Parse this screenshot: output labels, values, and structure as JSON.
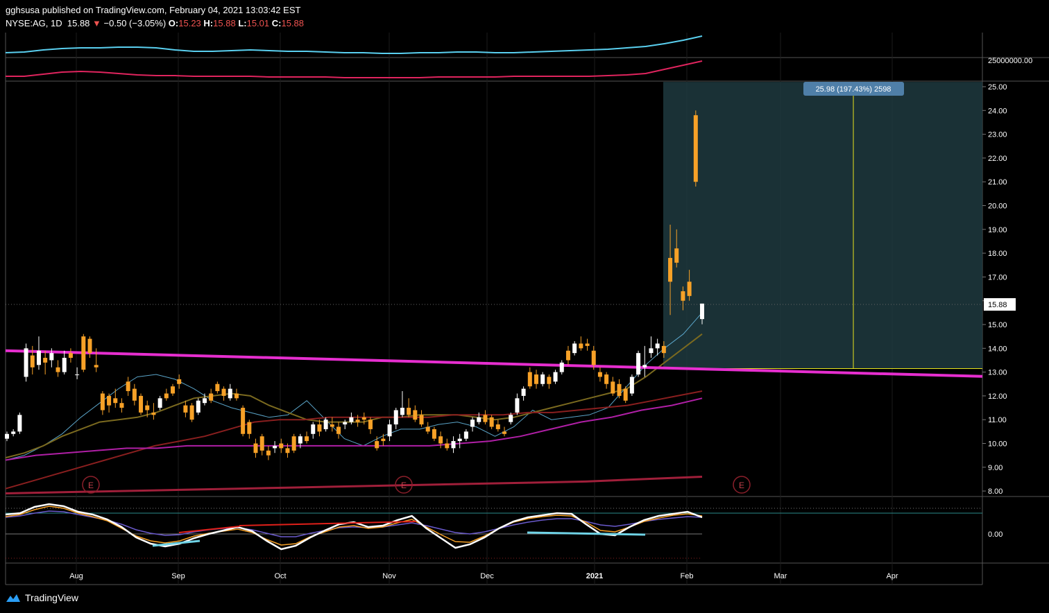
{
  "header": {
    "line1": "gghsusa published on TradingView.com, February 04, 2021 13:03:42 EST",
    "symbol": "NYSE:AG, 1D",
    "last": "15.88",
    "arrow": "▼",
    "change": "−0.50 (−3.05%)",
    "o_label": "O:",
    "o_value": "15.23",
    "h_label": "H:",
    "h_value": "15.88",
    "l_label": "L:",
    "l_value": "15.01",
    "c_label": "C:",
    "c_value": "15.88"
  },
  "footer": {
    "brand": "TradingView"
  },
  "colors": {
    "up_candle": "#ffffff",
    "down_candle": "#f7a127",
    "trendline": "#e62ecf",
    "ma_fast": "#5aa4c8",
    "ma_mid": "#7b6a1f",
    "ma_slow": "#8a1f1f",
    "ma_long": "#b01fa6",
    "projection_fill": "#1f3a3f",
    "volume_ma_top": "#5ad0f0",
    "volume_ma_bottom": "#e0245e"
  },
  "chart_data": {
    "type": "candlestick",
    "price_axis": [
      "25.00",
      "24.00",
      "23.00",
      "22.00",
      "21.00",
      "20.00",
      "19.00",
      "18.00",
      "17.00",
      "16.00",
      "15.00",
      "14.00",
      "13.00",
      "12.00",
      "11.00",
      "10.00",
      "9.00",
      "8.00"
    ],
    "ylim": [
      7.8,
      25.2
    ],
    "current_price_label": "15.88",
    "volume_axis_label": "25000000.00",
    "oscillator_axis_label": "0.00",
    "x_labels": [
      "Aug",
      "Sep",
      "Oct",
      "Nov",
      "Dec",
      "2021",
      "Feb",
      "Mar",
      "Apr"
    ],
    "earnings_marker": "E",
    "projection_label": "25.98 (197.43%) 2598",
    "projection": {
      "from_price": 13.15,
      "to_price": 25.2,
      "start_date": "2021-01-23",
      "end_date": "2021-03-19"
    },
    "trendline": {
      "start": 13.9,
      "end": 12.82
    },
    "candles": [
      [
        10.2,
        10.5,
        10.1,
        10.4
      ],
      [
        10.4,
        10.6,
        10.3,
        10.5
      ],
      [
        10.5,
        11.3,
        10.4,
        11.2
      ],
      [
        12.8,
        14.2,
        12.6,
        14.0
      ],
      [
        13.7,
        14.1,
        12.9,
        13.2
      ],
      [
        13.3,
        14.5,
        13.1,
        13.9
      ],
      [
        13.6,
        13.9,
        12.9,
        13.4
      ],
      [
        13.5,
        14.0,
        13.2,
        13.8
      ],
      [
        13.2,
        13.5,
        12.8,
        13.0
      ],
      [
        13.0,
        13.9,
        12.9,
        13.6
      ],
      [
        13.8,
        14.0,
        13.4,
        13.6
      ],
      [
        12.9,
        13.2,
        12.7,
        12.9
      ],
      [
        14.5,
        14.6,
        13.0,
        13.1
      ],
      [
        14.4,
        14.5,
        13.6,
        13.8
      ],
      [
        13.3,
        14.0,
        13.0,
        13.2
      ],
      [
        12.1,
        12.2,
        11.2,
        11.4
      ],
      [
        12.0,
        12.1,
        11.3,
        11.6
      ],
      [
        11.9,
        12.3,
        11.5,
        11.7
      ],
      [
        11.7,
        11.9,
        11.3,
        11.5
      ],
      [
        12.6,
        12.8,
        12.0,
        12.2
      ],
      [
        12.3,
        12.5,
        11.6,
        11.8
      ],
      [
        12.0,
        12.1,
        11.2,
        11.3
      ],
      [
        11.6,
        11.8,
        11.1,
        11.4
      ],
      [
        11.3,
        11.7,
        11.0,
        11.2
      ],
      [
        11.5,
        12.0,
        11.4,
        11.9
      ],
      [
        12.1,
        12.3,
        11.8,
        11.9
      ],
      [
        12.4,
        12.5,
        12.0,
        12.1
      ],
      [
        12.7,
        12.9,
        12.3,
        12.5
      ],
      [
        11.6,
        11.8,
        11.1,
        11.3
      ],
      [
        11.6,
        11.7,
        10.9,
        11.0
      ],
      [
        11.3,
        11.9,
        11.2,
        11.8
      ],
      [
        11.7,
        12.1,
        11.6,
        11.9
      ],
      [
        12.1,
        12.3,
        11.7,
        11.8
      ],
      [
        12.5,
        12.6,
        12.1,
        12.2
      ],
      [
        12.3,
        12.4,
        11.8,
        12.0
      ],
      [
        11.9,
        12.5,
        11.8,
        12.3
      ],
      [
        12.1,
        12.3,
        11.8,
        11.9
      ],
      [
        11.5,
        11.6,
        10.3,
        10.4
      ],
      [
        10.9,
        11.0,
        10.2,
        10.4
      ],
      [
        10.0,
        10.2,
        9.4,
        9.6
      ],
      [
        10.3,
        10.4,
        9.5,
        9.7
      ],
      [
        9.7,
        9.9,
        9.3,
        9.5
      ],
      [
        9.8,
        10.1,
        9.6,
        9.9
      ],
      [
        10.0,
        10.2,
        9.6,
        9.8
      ],
      [
        9.8,
        10.0,
        9.4,
        9.6
      ],
      [
        10.3,
        10.4,
        9.6,
        9.7
      ],
      [
        10.0,
        10.4,
        9.8,
        10.3
      ],
      [
        10.3,
        10.5,
        10.0,
        10.1
      ],
      [
        10.4,
        10.9,
        10.2,
        10.8
      ],
      [
        10.8,
        11.0,
        10.3,
        10.5
      ],
      [
        10.6,
        11.1,
        10.5,
        11.0
      ],
      [
        10.8,
        11.1,
        10.5,
        10.7
      ],
      [
        10.7,
        10.9,
        10.2,
        10.4
      ],
      [
        10.8,
        11.0,
        10.6,
        10.9
      ],
      [
        10.9,
        11.3,
        10.8,
        11.1
      ],
      [
        11.0,
        11.2,
        10.7,
        10.9
      ],
      [
        11.1,
        11.3,
        10.8,
        11.0
      ],
      [
        11.0,
        11.1,
        10.4,
        10.6
      ],
      [
        10.1,
        10.3,
        9.7,
        9.8
      ],
      [
        10.2,
        10.4,
        9.9,
        10.1
      ],
      [
        10.3,
        11.0,
        10.1,
        10.8
      ],
      [
        10.8,
        11.5,
        10.6,
        11.4
      ],
      [
        11.2,
        12.2,
        11.1,
        11.5
      ],
      [
        11.5,
        11.9,
        11.1,
        11.2
      ],
      [
        11.4,
        11.6,
        10.9,
        11.0
      ],
      [
        11.2,
        11.4,
        10.7,
        10.8
      ],
      [
        10.7,
        10.9,
        10.4,
        10.5
      ],
      [
        10.6,
        10.7,
        10.1,
        10.2
      ],
      [
        10.3,
        10.5,
        9.8,
        10.0
      ],
      [
        10.0,
        10.2,
        9.7,
        9.8
      ],
      [
        9.8,
        10.3,
        9.6,
        10.1
      ],
      [
        10.1,
        10.4,
        9.8,
        10.2
      ],
      [
        10.2,
        10.6,
        10.1,
        10.5
      ],
      [
        10.7,
        11.1,
        10.5,
        11.0
      ],
      [
        10.9,
        11.3,
        10.8,
        11.1
      ],
      [
        11.2,
        11.4,
        10.8,
        10.9
      ],
      [
        11.1,
        11.2,
        10.6,
        10.7
      ],
      [
        10.8,
        11.0,
        10.5,
        10.6
      ],
      [
        10.5,
        10.7,
        10.3,
        10.4
      ],
      [
        10.9,
        11.3,
        10.8,
        11.2
      ],
      [
        11.3,
        12.1,
        11.2,
        11.9
      ],
      [
        12.0,
        12.4,
        11.8,
        12.3
      ],
      [
        13.0,
        13.2,
        12.3,
        12.4
      ],
      [
        12.9,
        13.1,
        12.3,
        12.5
      ],
      [
        12.5,
        13.0,
        12.4,
        12.9
      ],
      [
        12.8,
        12.9,
        12.3,
        12.5
      ],
      [
        12.6,
        13.1,
        12.5,
        13.0
      ],
      [
        13.0,
        13.5,
        12.9,
        13.4
      ],
      [
        13.9,
        14.1,
        13.3,
        13.5
      ],
      [
        13.8,
        14.3,
        13.7,
        14.2
      ],
      [
        14.2,
        14.5,
        13.9,
        14.0
      ],
      [
        14.2,
        14.4,
        13.9,
        14.1
      ],
      [
        13.9,
        14.1,
        13.1,
        13.3
      ],
      [
        13.0,
        13.2,
        12.6,
        12.8
      ],
      [
        12.9,
        13.0,
        12.3,
        12.5
      ],
      [
        12.6,
        12.8,
        12.0,
        12.1
      ],
      [
        12.5,
        12.7,
        11.9,
        12.0
      ],
      [
        12.3,
        12.4,
        11.7,
        11.8
      ],
      [
        12.1,
        12.9,
        12.0,
        12.8
      ],
      [
        12.9,
        13.9,
        12.8,
        13.8
      ],
      [
        13.2,
        14.1,
        12.8,
        13.3
      ],
      [
        13.8,
        14.5,
        13.6,
        14.0
      ],
      [
        14.0,
        14.4,
        13.7,
        14.2
      ],
      [
        14.1,
        14.3,
        13.6,
        13.8
      ],
      [
        17.8,
        19.2,
        15.4,
        16.8
      ],
      [
        18.2,
        19.0,
        17.4,
        17.6
      ],
      [
        16.4,
        16.6,
        15.6,
        16.0
      ],
      [
        16.8,
        17.3,
        16.0,
        16.2
      ],
      [
        23.8,
        24.0,
        20.8,
        21.0
      ],
      [
        15.23,
        15.88,
        15.01,
        15.88
      ]
    ],
    "ma_fast": [
      9.3,
      9.5,
      9.9,
      10.4,
      11.1,
      11.7,
      12.3,
      12.8,
      12.9,
      12.7,
      12.3,
      11.8,
      11.5,
      11.3,
      11.1,
      11.2,
      11.8,
      11.0,
      10.2,
      9.9,
      10.3,
      10.6,
      10.6,
      10.8,
      10.9,
      10.7,
      10.3,
      10.7,
      11.4,
      11.0,
      11.1,
      11.2,
      11.5,
      12.4,
      13.3,
      14.0,
      14.6,
      15.5
    ],
    "ma_mid": [
      9.4,
      9.6,
      9.9,
      10.3,
      10.6,
      10.9,
      11.0,
      11.1,
      11.3,
      11.6,
      11.9,
      12.0,
      12.1,
      12.0,
      11.6,
      11.3,
      11.0,
      10.9,
      10.9,
      10.9,
      11.1,
      11.1,
      11.2,
      11.2,
      11.2,
      11.1,
      11.0,
      11.1,
      11.3,
      11.5,
      11.7,
      11.9,
      12.1,
      12.3,
      12.8,
      13.4,
      14.0,
      14.6
    ],
    "ma_slow": [
      8.1,
      8.4,
      8.7,
      9.0,
      9.3,
      9.6,
      9.9,
      10.1,
      10.3,
      10.6,
      10.9,
      11.0,
      11.0,
      11.1,
      11.1,
      11.1,
      11.1,
      11.1,
      11.2,
      11.2,
      11.2,
      11.3,
      11.3,
      11.4,
      11.5,
      11.6,
      11.8,
      12.0,
      12.2
    ],
    "ma_long": [
      9.3,
      9.5,
      9.6,
      9.7,
      9.8,
      9.8,
      9.9,
      9.9,
      9.9,
      9.9,
      9.9,
      9.9,
      9.9,
      9.9,
      9.9,
      10.0,
      10.1,
      10.3,
      10.6,
      10.9,
      11.1,
      11.4,
      11.6,
      11.9
    ],
    "ma_200": [
      7.9,
      7.95,
      8.0,
      8.05,
      8.1,
      8.15,
      8.2,
      8.25,
      8.3,
      8.35,
      8.4,
      8.5,
      8.6
    ]
  }
}
